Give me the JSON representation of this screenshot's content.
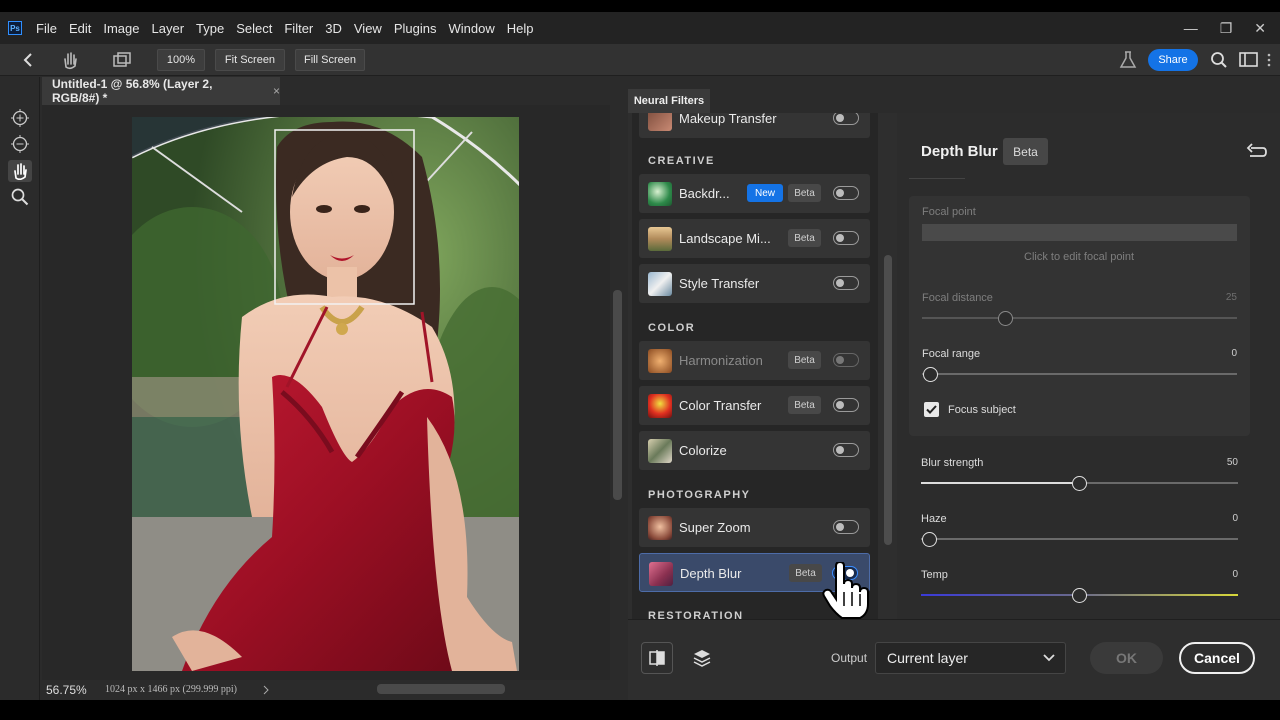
{
  "app": {
    "logo": "Ps",
    "accent": "#1473e6"
  },
  "menu": [
    "File",
    "Edit",
    "Image",
    "Layer",
    "Type",
    "Select",
    "Filter",
    "3D",
    "View",
    "Plugins",
    "Window",
    "Help"
  ],
  "window_controls": {
    "minimize": "—",
    "restore": "❐",
    "close": "✕"
  },
  "options_bar": {
    "zoom": "100%",
    "fit_screen": "Fit Screen",
    "fill_screen": "Fill Screen",
    "share": "Share"
  },
  "document": {
    "tab_title": "Untitled-1 @ 56.8% (Layer 2, RGB/8#) *",
    "close": "×"
  },
  "status": {
    "zoom": "56.75%",
    "dimensions": "1024 px x 1466 px (299.999 ppi)"
  },
  "panel": {
    "title": "Neural Filters"
  },
  "filters": {
    "partial_top": "Makeup Transfer",
    "creative_label": "CREATIVE",
    "color_label": "COLOR",
    "photography_label": "PHOTOGRAPHY",
    "restoration_label": "RESTORATION",
    "items": [
      {
        "name": "Backdr...",
        "badges": [
          "New",
          "Beta"
        ],
        "enabled": false
      },
      {
        "name": "Landscape Mi...",
        "badges": [
          "Beta"
        ],
        "enabled": false
      },
      {
        "name": "Style Transfer",
        "badges": [],
        "enabled": false
      },
      {
        "name": "Harmonization",
        "badges": [
          "Beta"
        ],
        "enabled": false,
        "disabled": true
      },
      {
        "name": "Color Transfer",
        "badges": [
          "Beta"
        ],
        "enabled": false
      },
      {
        "name": "Colorize",
        "badges": [],
        "enabled": false
      },
      {
        "name": "Super Zoom",
        "badges": [],
        "enabled": false
      },
      {
        "name": "Depth Blur",
        "badges": [
          "Beta"
        ],
        "enabled": true,
        "selected": true
      }
    ]
  },
  "settings": {
    "title": "Depth Blur",
    "beta": "Beta",
    "focal_point_label": "Focal point",
    "focal_point_hint": "Click to edit focal point",
    "focal_distance_label": "Focal distance",
    "focal_distance_value": "25",
    "focal_range_label": "Focal range",
    "focal_range_value": "0",
    "focus_subject_label": "Focus subject",
    "focus_subject_checked": true,
    "blur_strength_label": "Blur strength",
    "blur_strength_value": "50",
    "haze_label": "Haze",
    "haze_value": "0",
    "temp_label": "Temp",
    "temp_value": "0"
  },
  "bottom": {
    "output_label": "Output",
    "output_value": "Current layer",
    "ok": "OK",
    "cancel": "Cancel"
  }
}
